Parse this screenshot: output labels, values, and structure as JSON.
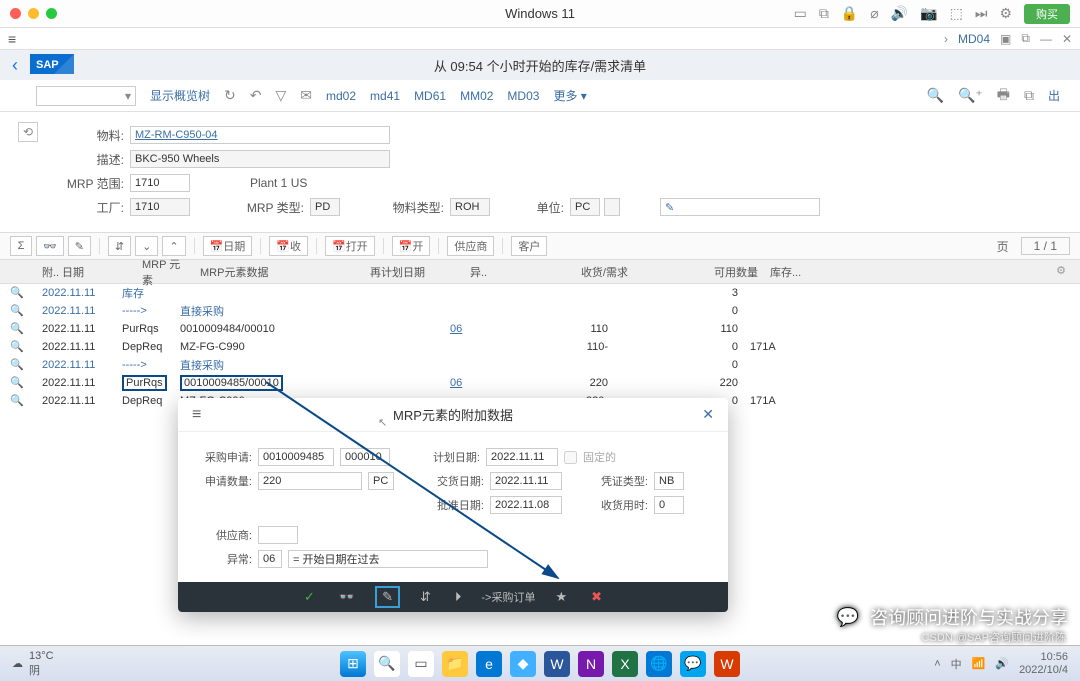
{
  "mac": {
    "title": "Windows 11",
    "buy": "购买"
  },
  "sapTop": {
    "tx": "MD04"
  },
  "sapHeader": {
    "title": "从 09:54 个小时开始的库存/需求清单"
  },
  "toolbar": {
    "tree": "显示概览树",
    "md02": "md02",
    "md41": "md41",
    "md61": "MD61",
    "mm02": "MM02",
    "md03": "MD03",
    "more": "更多 ▾",
    "exit": "出"
  },
  "form": {
    "material_lbl": "物料:",
    "material": "MZ-RM-C950-04",
    "descr_lbl": "描述:",
    "descr": "BKC-950 Wheels",
    "mrparea_lbl": "MRP 范围:",
    "mrparea": "1710",
    "plant_name": "Plant 1 US",
    "plant_lbl": "工厂:",
    "plant": "1710",
    "mrptype_lbl": "MRP 类型:",
    "mrptype": "PD",
    "mattype_lbl": "物料类型:",
    "mattype": "ROH",
    "uom_lbl": "单位:",
    "uom": "PC"
  },
  "gridToolbar": {
    "date": "日期",
    "receipt": "收",
    "open": "打开",
    "open2": "开",
    "vendor": "供应商",
    "customer": "客户",
    "page": "页",
    "pageVal": "1  /  1"
  },
  "gridHead": {
    "att": "附..",
    "date": "日期",
    "mrp": "MRP 元素",
    "data": "MRP元素数据",
    "replan": "再计划日期",
    "exc": "异..",
    "recreq": "收货/需求",
    "avail": "可用数量",
    "stor": "库存..."
  },
  "rows": [
    {
      "date": "2022.11.11",
      "mrp": "库存",
      "data": "",
      "replan": "",
      "exc": "",
      "recreq": "",
      "avail": "3",
      "stor": "",
      "link": true
    },
    {
      "date": "2022.11.11",
      "mrp": "----->",
      "data": "直接采购",
      "replan": "",
      "exc": "",
      "recreq": "",
      "avail": "0",
      "stor": "",
      "link": true,
      "dataLink": true
    },
    {
      "date": "2022.11.11",
      "mrp": "PurRqs",
      "data": "0010009484/00010",
      "replan": "",
      "exc": "06",
      "recreq": "110",
      "avail": "110",
      "stor": ""
    },
    {
      "date": "2022.11.11",
      "mrp": "DepReq",
      "data": "MZ-FG-C990",
      "replan": "",
      "exc": "",
      "recreq": "110-",
      "avail": "0",
      "stor": "171A"
    },
    {
      "date": "2022.11.11",
      "mrp": "----->",
      "data": "直接采购",
      "replan": "",
      "exc": "",
      "recreq": "",
      "avail": "0",
      "stor": "",
      "link": true,
      "dataLink": true
    },
    {
      "date": "2022.11.11",
      "mrp": "PurRqs",
      "data": "0010009485/00010",
      "replan": "",
      "exc": "06",
      "recreq": "220",
      "avail": "220",
      "stor": "",
      "hl": true
    },
    {
      "date": "2022.11.11",
      "mrp": "DepReq",
      "data": "MZ-FG-C990",
      "replan": "",
      "exc": "",
      "recreq": "220-",
      "avail": "0",
      "stor": "171A"
    }
  ],
  "popup": {
    "title": "MRP元素的附加数据",
    "pr_lbl": "采购申请:",
    "pr_no": "0010009485",
    "pr_item": "000010",
    "qty_lbl": "申请数量:",
    "qty": "220",
    "uom": "PC",
    "vendor_lbl": "供应商:",
    "exc_lbl": "异常:",
    "exc": "06",
    "exc_text": "= 开始日期在过去",
    "plandate_lbl": "计划日期:",
    "plandate": "2022.11.11",
    "fixed_lbl": "固定的",
    "deldate_lbl": "交货日期:",
    "deldate": "2022.11.11",
    "reldate_lbl": "批准日期:",
    "reldate": "2022.11.08",
    "doctype_lbl": "凭证类型:",
    "doctype": "NB",
    "grtime_lbl": "收货用时:",
    "grtime": "0",
    "po_link": "->采购订单"
  },
  "watermark": {
    "main": "咨询顾问进阶与实战分享",
    "sub": "CSDN @SAP咨询顾问进阶陈"
  },
  "taskbar": {
    "temp": "13°C",
    "weather": "阴",
    "time": "10:56",
    "date": "2022/10/4"
  }
}
